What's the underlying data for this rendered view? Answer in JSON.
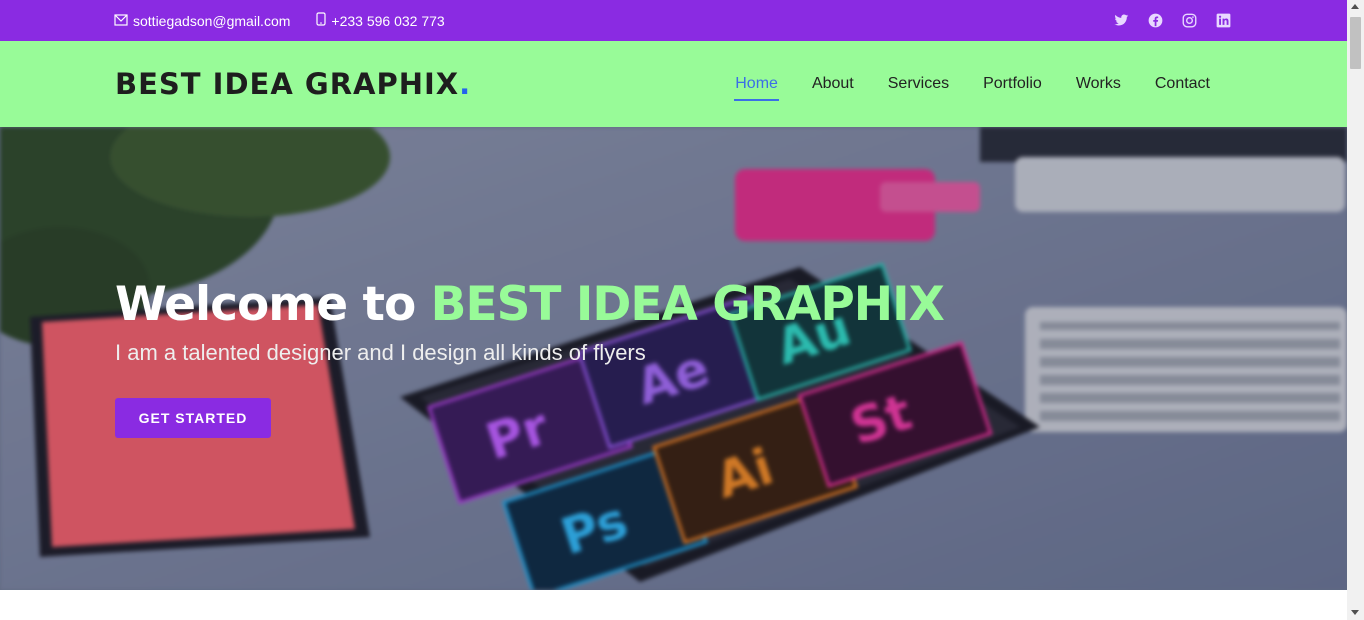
{
  "topbar": {
    "email": "sottiegadson@gmail.com",
    "phone": "+233 596 032 773",
    "social": [
      "twitter-icon",
      "facebook-icon",
      "instagram-icon",
      "linkedin-icon"
    ],
    "background": "#8a2be2"
  },
  "header": {
    "logo": "BEST IDEA GRAPHIX",
    "logo_dot": ".",
    "background": "#98fb98",
    "nav": [
      {
        "label": "Home",
        "active": true
      },
      {
        "label": "About",
        "active": false
      },
      {
        "label": "Services",
        "active": false
      },
      {
        "label": "Portfolio",
        "active": false
      },
      {
        "label": "Works",
        "active": false
      },
      {
        "label": "Contact",
        "active": false
      }
    ]
  },
  "hero": {
    "title_prefix": "Welcome to ",
    "title_brand": "BEST IDEA GRAPHIX",
    "subtitle": "I am a talented designer and I design all kinds of flyers",
    "cta": "GET STARTED",
    "tiles": [
      "Pr",
      "Ae",
      "Au",
      "Ps",
      "Ai",
      "St"
    ]
  }
}
